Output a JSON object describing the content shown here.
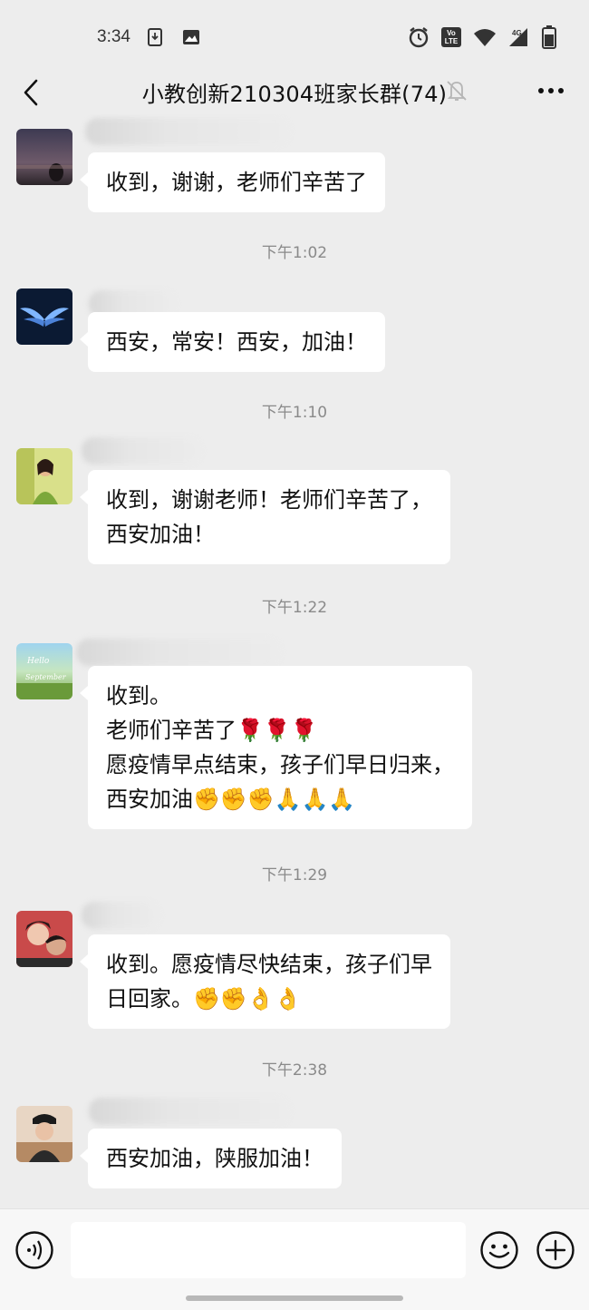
{
  "status": {
    "time": "3:34",
    "left_icons": [
      "sim-download-icon",
      "image-icon"
    ],
    "right_icons": [
      "alarm-icon",
      "volte-icon",
      "wifi-icon",
      "signal-4g-icon",
      "battery-icon"
    ],
    "volte_text": "Vo LTE",
    "network": "4G"
  },
  "header": {
    "title": "小教创新210304班家长群(74)",
    "back_icon": "chevron-left-icon",
    "mute_icon": "bell-off-icon",
    "more_icon": "more-dots-icon"
  },
  "messages": [
    {
      "time": "",
      "text": "收到，谢谢，老师们辛苦了"
    },
    {
      "time": "下午1:02",
      "text": "西安，常安！西安，加油！"
    },
    {
      "time": "下午1:10",
      "text": "收到，谢谢老师！老师们辛苦了，\n西安加油！"
    },
    {
      "time": "下午1:22",
      "text": "收到。\n老师们辛苦了🌹🌹🌹\n愿疫情早点结束，孩子们早日归来，\n西安加油✊✊✊🙏🙏🙏"
    },
    {
      "time": "下午1:29",
      "text": "收到。愿疫情尽快结束，孩子们早\n日回家。✊✊👌👌"
    },
    {
      "time": "下午2:38",
      "text": "西安加油，陕服加油！"
    }
  ],
  "avatar_texts": {
    "hello": "Hello",
    "september": "September"
  },
  "input": {
    "placeholder": "",
    "voice_icon": "voice-icon",
    "emoji_icon": "emoji-icon",
    "plus_icon": "plus-icon"
  },
  "colors": {
    "background": "#ededed",
    "bubble": "#ffffff",
    "time_text": "#8a8a8a",
    "input_bar": "#f7f7f7"
  }
}
